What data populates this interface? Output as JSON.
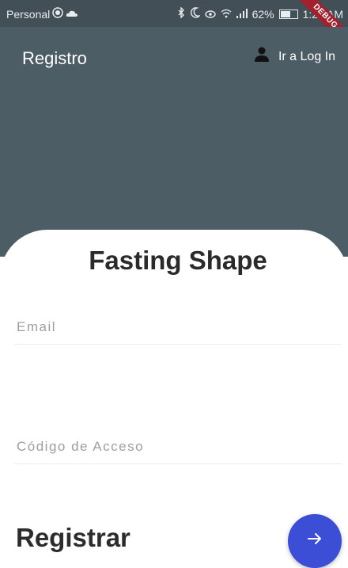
{
  "status_bar": {
    "carrier": "Personal",
    "battery": "62%",
    "battery_level": 0.62,
    "time": "1:28 AM",
    "icons": [
      "alarm-icon",
      "cloud-icon",
      "bluetooth-icon",
      "moon-icon",
      "eye-icon",
      "wifi-icon",
      "signal-icon"
    ],
    "debug_label": "DEBUG"
  },
  "app_bar": {
    "title": "Registro",
    "login_label": "Ir a Log In",
    "login_icon": "person-icon",
    "color": "#4d5d66"
  },
  "form": {
    "title": "Fasting Shape",
    "email_placeholder": "Email",
    "access_code_placeholder": "Código de Acceso"
  },
  "footer": {
    "register_label": "Registrar",
    "submit_icon": "arrow-right-icon",
    "fab_color": "#3d4ed6"
  }
}
